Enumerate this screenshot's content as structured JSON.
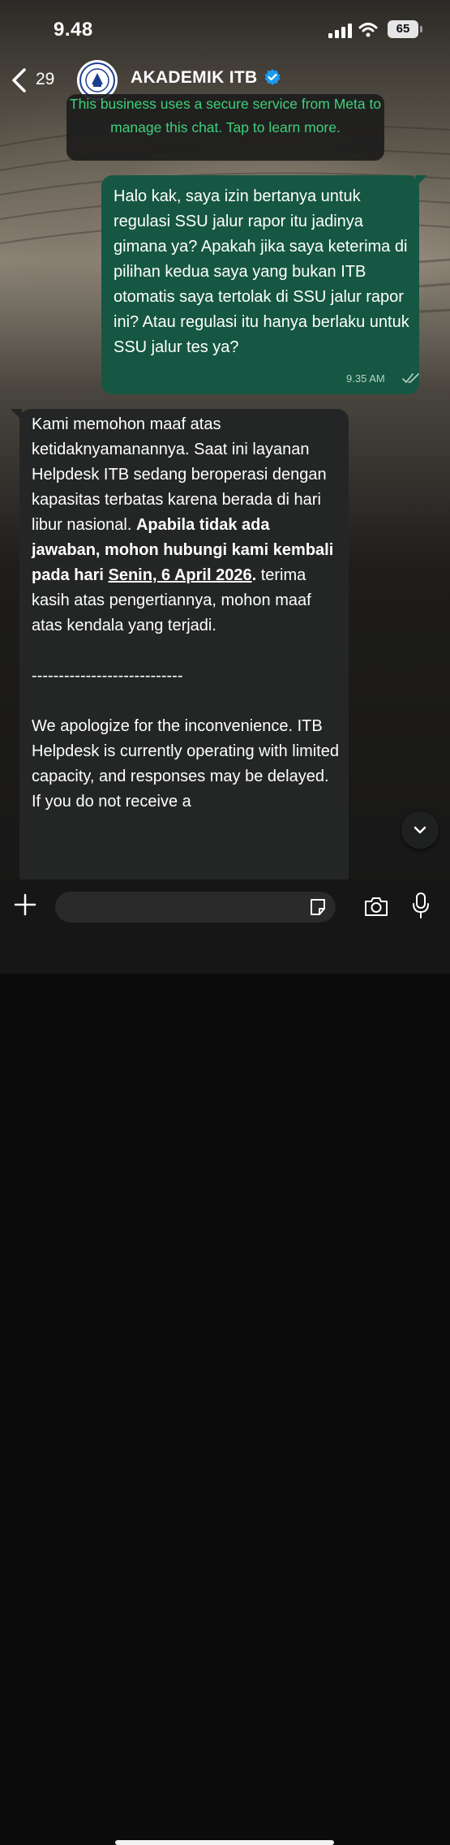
{
  "status_bar": {
    "time": "9.48",
    "battery": "65"
  },
  "header": {
    "back_count": "29",
    "contact_name": "AKADEMIK ITB"
  },
  "notice": {
    "text": "This business uses a secure service from Meta to manage this chat. Tap to learn more."
  },
  "outgoing": {
    "text": "Halo kak, saya izin bertanya untuk regulasi SSU jalur rapor itu jadinya gimana ya? Apakah jika saya keterima di pilihan kedua saya yang bukan ITB otomatis saya tertolak di SSU jalur rapor ini? Atau regulasi itu hanya berlaku untuk SSU jalur tes ya?",
    "time": "9.35 AM"
  },
  "incoming": {
    "p1": "Kami memohon maaf atas ketidaknyamanannya. Saat ini layanan Helpdesk ITB sedang beroperasi dengan kapasitas terbatas karena berada di hari libur nasional.",
    "bold1": "Apabila tidak ada jawaban, mohon hubungi kami kembali pada hari",
    "date": "Senin, 6 April 2026",
    "bold_end": ".",
    "p1_end": "terima kasih atas pengertiannya, mohon maaf atas kendala yang terjadi.",
    "divider": "----------------------------",
    "p2": "We apologize for the inconvenience. ITB Helpdesk is currently operating with limited capacity, and responses may be delayed. If you do not receive a"
  },
  "composer": {
    "placeholder": ""
  },
  "colors": {
    "outgoing_bubble": "#155742",
    "incoming_bubble": "#242626",
    "accent_green": "#3fd07a",
    "verified_blue": "#1d9bf0"
  },
  "icons": [
    "back-chevron-icon",
    "verified-badge-icon",
    "chevron-down-icon",
    "plus-icon",
    "sticker-icon",
    "camera-icon",
    "microphone-icon",
    "double-check-icon",
    "signal-icon",
    "wifi-icon"
  ]
}
